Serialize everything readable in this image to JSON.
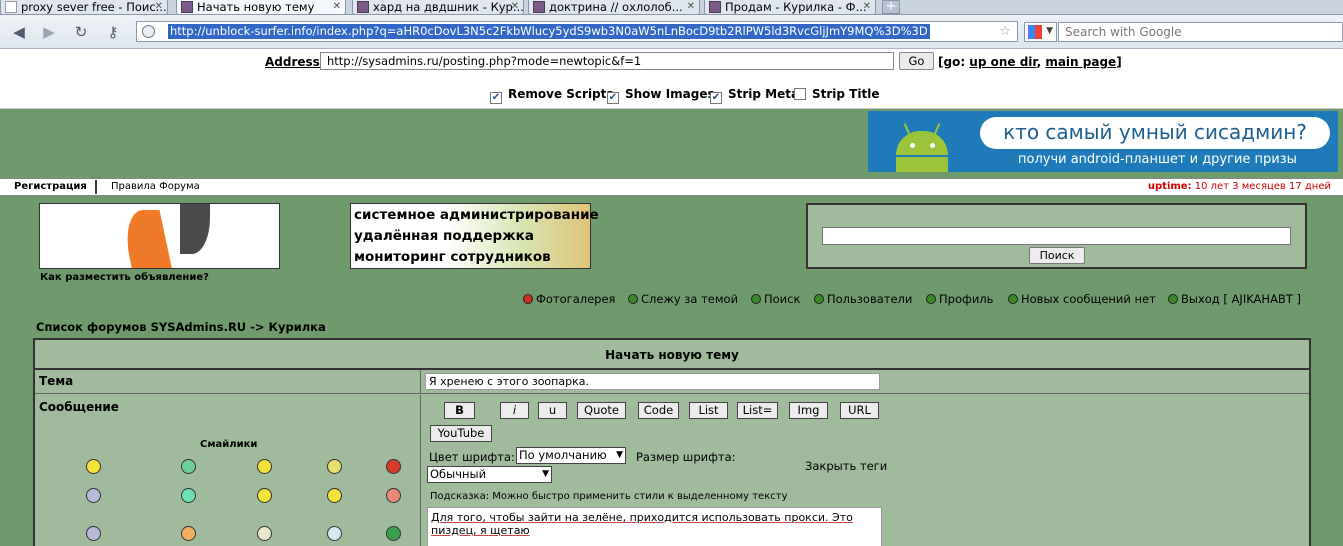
{
  "browser": {
    "tabs": [
      {
        "label": "proxy sever free - Поис..."
      },
      {
        "label": "Начать новую тему"
      },
      {
        "label": "хард на двдшник - Кур..."
      },
      {
        "label": "доктрина // охлолоб..."
      },
      {
        "label": "Продам - Курилка - Ф..."
      }
    ],
    "new_tab": "+",
    "url": "http://unblock-surfer.info/index.php?q=aHR0cDovL3N5c2FkbWlucy5ydS9wb3N0aW5nLnBocD9tb2RlPW5ld3RvcGljJmY9MQ%3D%3D",
    "search_placeholder": "Search with Google"
  },
  "proxy": {
    "address_label": "Address:",
    "address_value": "http://sysadmins.ru/posting.php?mode=newtopic&f=1",
    "go_label": "Go",
    "go_prefix": "[go: ",
    "up_one_dir": "up one dir",
    "comma": ", ",
    "main_page": "main page",
    "go_suffix": "]",
    "options": [
      {
        "label": "Remove Scripts",
        "checked": true
      },
      {
        "label": "Show Images",
        "checked": true
      },
      {
        "label": "Strip Meta",
        "checked": true
      },
      {
        "label": "Strip Title",
        "checked": false
      }
    ]
  },
  "banner": {
    "headline": "кто самый умный сисадмин?",
    "subline": "получи android-планшет и другие призы"
  },
  "topmenu": {
    "register": "Регистрация",
    "rules": "Правила Форума",
    "uptime_label": "uptime:",
    "uptime_value": " 10 лет 3 месяцев 17 дней"
  },
  "logo_link": "Как разместить объявление?",
  "ad_lines": [
    "системное администрирование",
    "удалённая поддержка",
    "мониторинг сотрудников"
  ],
  "search_button": "Поиск",
  "usermenu": [
    {
      "label": "Фотогалерея",
      "color": "#d03020"
    },
    {
      "label": "Слежу за темой",
      "color": "#3a8a2a"
    },
    {
      "label": "Поиск",
      "color": "#3a8a2a"
    },
    {
      "label": "Пользователи",
      "color": "#3a8a2a"
    },
    {
      "label": "Профиль",
      "color": "#3a8a2a"
    },
    {
      "label": "Новых сообщений нет",
      "color": "#3a8a2a"
    },
    {
      "label": "Выход [ AJIKAHABT ]",
      "color": "#3a8a2a"
    }
  ],
  "breadcrumb": "Список форумов SYSAdmins.RU -> Курилка",
  "post": {
    "header": "Начать новую тему",
    "topic_label": "Тема",
    "topic_value": "Я хренею с этого зоопарка.",
    "message_label": "Сообщение",
    "smilies_title": "Смайлики",
    "format_buttons": [
      "B",
      "i",
      "u",
      "Quote",
      "Code",
      "List",
      "List=",
      "Img",
      "URL"
    ],
    "youtube_button": "YouTube",
    "font_color_label": "Цвет шрифта:",
    "font_color_value": "По умолчанию",
    "font_size_label": "Размер шрифта:",
    "font_size_value": "Обычный",
    "close_tags": "Закрыть теги",
    "hint": "Подсказка: Можно быстро применить стили к выделенному тексту",
    "message_text": "Для того, чтобы зайти на зелёне, приходится использовать прокси. Это пиздец, я щетаю"
  },
  "colors": {
    "page_bg": "#6f9a6c",
    "panel_bg": "#9fbb9c",
    "uptime": "#cc0000",
    "banner": "#1e7ab8",
    "android": "#9bc43a",
    "url_highlight": "#3168c5"
  }
}
